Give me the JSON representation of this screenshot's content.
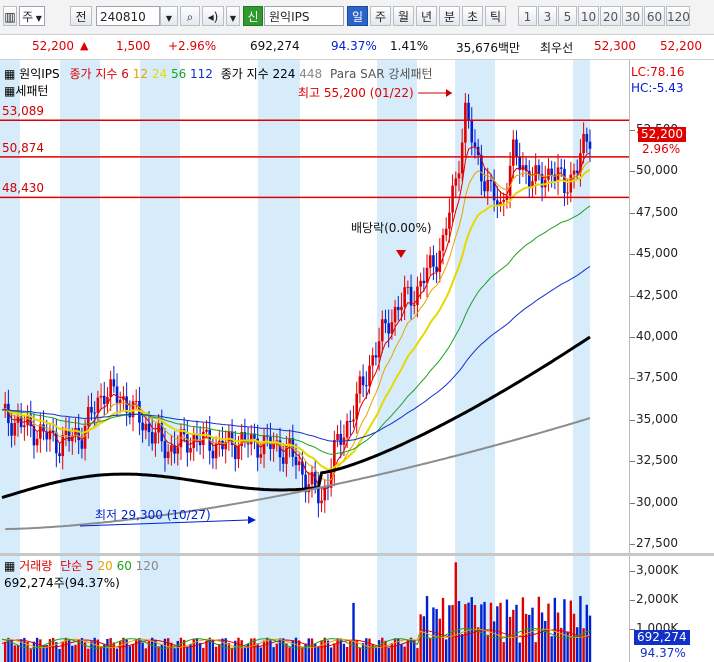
{
  "toolbar": {
    "market": "주",
    "period_btn": "전",
    "code": "240810",
    "badge": "신",
    "name": "원익IPS",
    "period_tabs": [
      {
        "label": "일",
        "active": true
      },
      {
        "label": "주",
        "active": false
      },
      {
        "label": "월",
        "active": false
      },
      {
        "label": "년",
        "active": false
      },
      {
        "label": "분",
        "active": false
      },
      {
        "label": "초",
        "active": false
      },
      {
        "label": "틱",
        "active": false
      }
    ],
    "intervals": [
      "1",
      "3",
      "5",
      "10",
      "20",
      "30",
      "60",
      "120"
    ]
  },
  "quote": {
    "price": "52,200",
    "change": "1,500",
    "change_pct": "+2.96%",
    "volume": "692,274",
    "vol_ratio": "94.37%",
    "turnover_pct": "1.41%",
    "amount": "35,676백만",
    "best_label": "최우선",
    "ask": "52,300",
    "bid": "52,200"
  },
  "price_pane": {
    "legend_title": "원익IPS",
    "legend_ma_name": "종가 지수 6",
    "legend_ma": [
      {
        "label": "12",
        "color": "#e8a100"
      },
      {
        "label": "24",
        "color": "#e8d800"
      },
      {
        "label": "56",
        "color": "#20a020"
      },
      {
        "label": "112",
        "color": "#1030d0"
      }
    ],
    "legend_ma2_name": "종가 지수 224",
    "legend_ma2_extra": "448",
    "legend_sar": "Para SAR 강세패턴",
    "pattern_label": "세패턴",
    "lc": "LC:78.16",
    "hc": "HC:-5.43",
    "high_label": "최고 55,200 (01/22)",
    "low_label": "최저 29,300 (10/27)",
    "dividend_label": "배당락(0.00%)",
    "levels": [
      {
        "label": "53,089",
        "value": 53089
      },
      {
        "label": "50,874",
        "value": 50874
      },
      {
        "label": "48,430",
        "value": 48430
      }
    ],
    "current_price": "52,200",
    "current_pct": "2.96%",
    "y_ticks": [
      "52,500",
      "50,000",
      "47,500",
      "45,000",
      "42,500",
      "40,000",
      "37,500",
      "35,000",
      "32,500",
      "30,000",
      "27,500"
    ]
  },
  "volume_pane": {
    "legend_title": "거래량",
    "legend_ma_name": "단순 5",
    "legend_ma": [
      {
        "label": "20",
        "color": "#e8a100"
      },
      {
        "label": "60",
        "color": "#20a020"
      },
      {
        "label": "120",
        "color": "#888888"
      }
    ],
    "volume_text": "692,274주(94.37%)",
    "y_ticks": [
      "3,000K",
      "2,000K",
      "1,000K"
    ],
    "current_volume": "692,274",
    "current_pct": "94.37%"
  },
  "colors": {
    "up": "#e00000",
    "down": "#0020d0",
    "band": "#d6ecfb",
    "ma200": "#000000",
    "ma448": "#8c8c8c"
  }
}
